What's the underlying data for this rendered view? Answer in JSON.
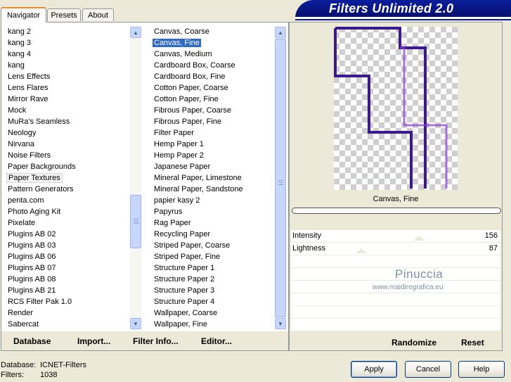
{
  "banner_title": "Filters Unlimited 2.0",
  "tabs": {
    "navigator": "Navigator",
    "presets": "Presets",
    "about": "About"
  },
  "categories": [
    "kang 2",
    "kang 3",
    "kang 4",
    "kang",
    "Lens Effects",
    "Lens Flares",
    "Mirror Rave",
    "Mock",
    "MuRa's Seamless",
    "Neology",
    "Nirvana",
    "Noise Filters",
    "Paper Backgrounds",
    "Paper Textures",
    "Pattern Generators",
    "penta.com",
    "Photo Aging Kit",
    "Pixelate",
    "Plugins AB 02",
    "Plugins AB 03",
    "Plugins AB 06",
    "Plugins AB 07",
    "Plugins AB 08",
    "Plugins AB 21",
    "RCS Filter Pak 1.0",
    "Render",
    "Sabercat"
  ],
  "filters": [
    "Canvas, Coarse",
    "Canvas, Fine",
    "Canvas, Medium",
    "Cardboard Box, Coarse",
    "Cardboard Box, Fine",
    "Cotton Paper, Coarse",
    "Cotton Paper, Fine",
    "Fibrous Paper, Coarse",
    "Fibrous Paper, Fine",
    "Filter Paper",
    "Hemp Paper 1",
    "Hemp Paper 2",
    "Japanese Paper",
    "Mineral Paper, Limestone",
    "Mineral Paper, Sandstone",
    "papier kasy 2",
    "Papyrus",
    "Rag Paper",
    "Recycling Paper",
    "Striped Paper, Coarse",
    "Striped Paper, Fine",
    "Structure Paper 1",
    "Structure Paper 2",
    "Structure Paper 3",
    "Structure Paper 4",
    "Wallpaper, Coarse",
    "Wallpaper, Fine"
  ],
  "left_buttons": {
    "database": "Database",
    "import": "Import...",
    "filter_info": "Filter Info...",
    "editor": "Editor..."
  },
  "preview": {
    "filter_name": "Canvas, Fine"
  },
  "sliders": [
    {
      "label": "Intensity",
      "value": "156"
    },
    {
      "label": "Lightness",
      "value": "87"
    }
  ],
  "watermark": {
    "line1": "Pinuccia",
    "line2": "www.maidiregrafica.eu"
  },
  "right_buttons": {
    "randomize": "Randomize",
    "reset": "Reset"
  },
  "footer": {
    "database_label": "Database:",
    "database_value": "ICNET-Filters",
    "filters_label": "Filters:",
    "filters_value": "1038"
  },
  "dialog_buttons": {
    "apply": "Apply",
    "cancel": "Cancel",
    "help": "Help"
  },
  "colors": {
    "selection": "#316ac5",
    "banner": "#0a1e9c",
    "preview_stroke": "#3a1a8e"
  }
}
